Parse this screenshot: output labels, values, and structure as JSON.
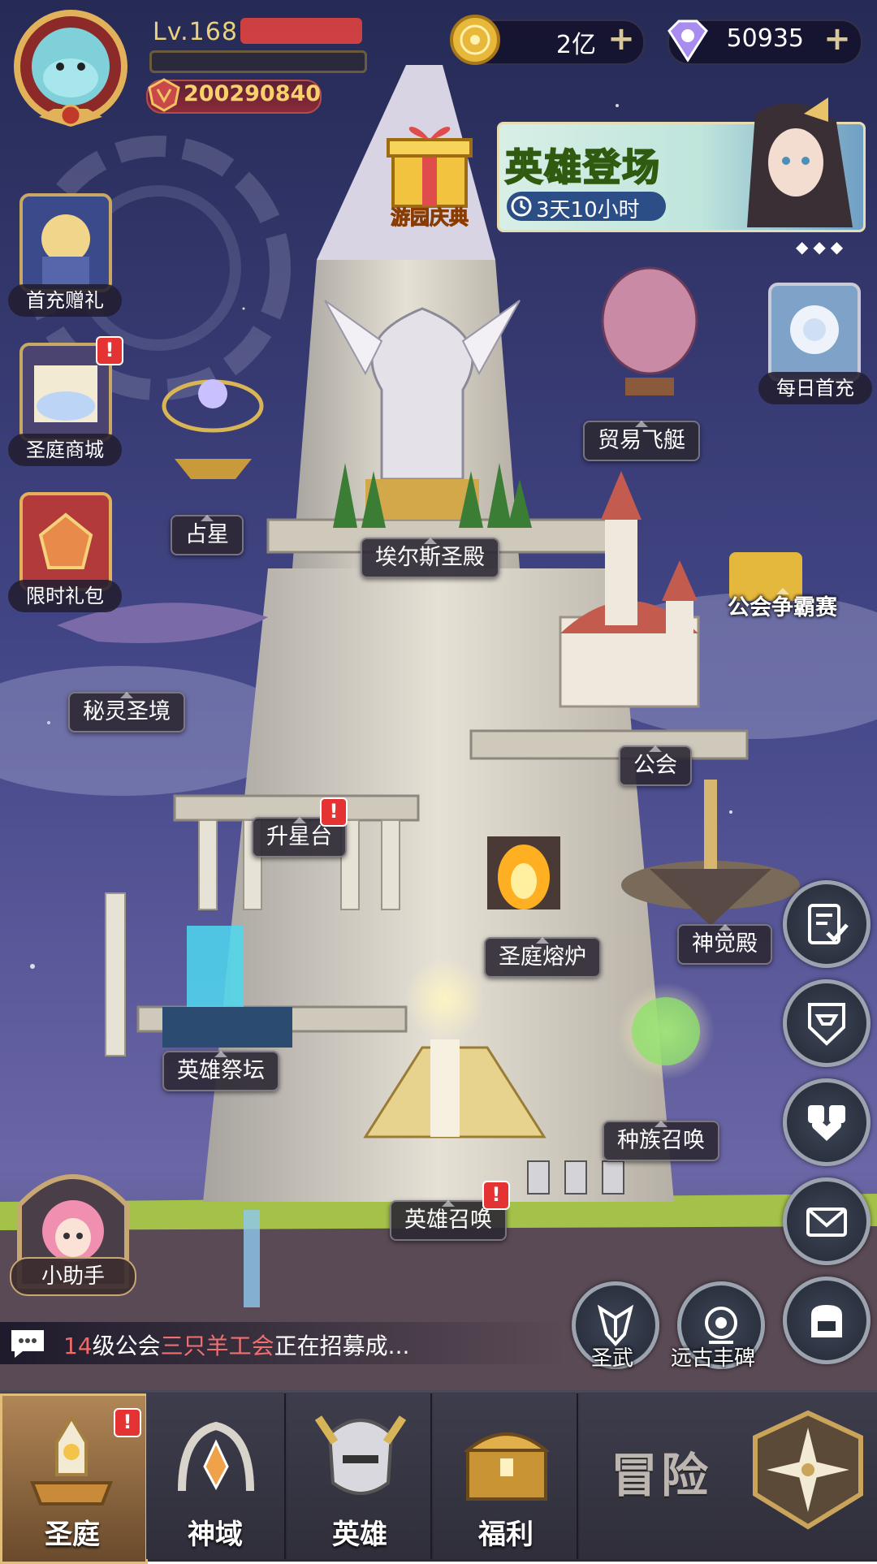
{
  "player": {
    "level": "Lv.168",
    "power": "200290840"
  },
  "resources": {
    "gold": "2亿",
    "gems": "50935",
    "plus_label": "+"
  },
  "event": {
    "gift_label": "游园庆典",
    "banner_title": "英雄登场",
    "banner_timer": "3天10小时"
  },
  "left_menu": [
    {
      "label": "首充赠礼"
    },
    {
      "label": "圣庭商城",
      "badge": "!"
    },
    {
      "label": "限时礼包"
    }
  ],
  "right_menu": [
    {
      "label": "每日首充"
    }
  ],
  "map_buildings": [
    {
      "label": "贸易飞艇"
    },
    {
      "label": "占星"
    },
    {
      "label": "埃尔斯圣殿"
    },
    {
      "label": "公会争霸赛"
    },
    {
      "label": "秘灵圣境"
    },
    {
      "label": "公会"
    },
    {
      "label": "升星台",
      "badge": "!"
    },
    {
      "label": "圣庭熔炉"
    },
    {
      "label": "神觉殿"
    },
    {
      "label": "英雄祭坛"
    },
    {
      "label": "种族召唤"
    },
    {
      "label": "英雄召唤",
      "badge": "!"
    }
  ],
  "quick_buttons": [
    {
      "icon": "task-checklist-icon"
    },
    {
      "icon": "guild-shield-icon"
    },
    {
      "icon": "friends-heart-icon"
    },
    {
      "icon": "mail-icon"
    },
    {
      "icon": "backpack-icon"
    }
  ],
  "bottom_round": [
    {
      "label": "圣武"
    },
    {
      "label": "远古丰碑"
    }
  ],
  "helper": {
    "label": "小助手"
  },
  "chat": {
    "level_part": "14",
    "text_a": "级公会",
    "guild_name": "三只羊工会",
    "text_b": "正在招募成..."
  },
  "bottom_nav": [
    {
      "label": "圣庭",
      "active": true,
      "badge": "!"
    },
    {
      "label": "神域"
    },
    {
      "label": "英雄"
    },
    {
      "label": "福利"
    },
    {
      "label": "冒险"
    }
  ],
  "colors": {
    "sky_top": "#2a2d5a",
    "sky_mid": "#4b4f8e",
    "sky_low": "#6f6aa8",
    "badge_red": "#e53232",
    "gold_text": "#f7d26b"
  }
}
